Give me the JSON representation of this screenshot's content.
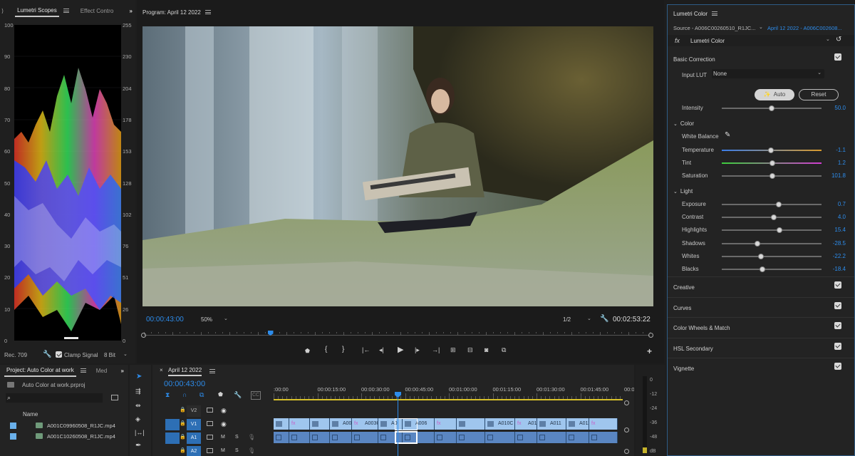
{
  "scopes": {
    "tab_active": "Lumetri Scopes",
    "tab_other": "Effect Contro",
    "left_scale": [
      "100",
      "90",
      "80",
      "70",
      "60",
      "50",
      "40",
      "30",
      "20",
      "10",
      "0"
    ],
    "right_scale": [
      "255",
      "230",
      "204",
      "178",
      "153",
      "128",
      "102",
      "76",
      "51",
      "26",
      "0"
    ],
    "colorspace": "Rec. 709",
    "clamp_label": "Clamp Signal",
    "bit_depth": "8 Bit"
  },
  "program": {
    "title": "Program: April 12 2022",
    "timecode": "00:00:43:00",
    "zoom": "50%",
    "resolution": "1/2",
    "duration": "00:02:53:22",
    "playhead_fraction": 0.25
  },
  "project": {
    "tab_active": "Project: Auto Color at work",
    "tab_other": "Med",
    "file": "Auto Color at work.prproj",
    "column_name": "Name",
    "items": [
      "A001C09960508_R1JC.mp4",
      "A001C10260508_R1JC.mp4"
    ]
  },
  "timeline": {
    "tab_label": "April 12 2022",
    "timecode": "00:00:43:00",
    "ruler": [
      ":00:00",
      "00:00:15:00",
      "00:00:30:00",
      "00:00:45:00",
      "00:01:00:00",
      "00:01:15:00",
      "00:01:30:00",
      "00:01:45:00",
      "00:02"
    ],
    "tracks": [
      {
        "name": "V2",
        "lock": "🔒"
      },
      {
        "name": "V1",
        "lock": "🔒"
      },
      {
        "name": "A1",
        "lock": "🔒",
        "m": "M",
        "s": "S"
      },
      {
        "name": "A2",
        "lock": "🔒",
        "m": "M",
        "s": "S"
      }
    ],
    "video_clips": [
      "",
      "",
      "",
      "A002",
      "A003C",
      "A0",
      "A006",
      "",
      "",
      "A010C",
      "A011C0",
      "A011",
      "A011C02",
      ""
    ],
    "audio_meter_scale": [
      "0",
      "-12",
      "-24",
      "-36",
      "-48",
      "dB"
    ]
  },
  "lumetri": {
    "title": "Lumetri Color",
    "source_label": "Source - A006C00260510_R1JC...",
    "sequence_label": "April 12 2022 - A006C002608...",
    "fx_label": "fx",
    "effect_name": "Lumetri Color",
    "basic_correction": "Basic Correction",
    "input_lut_label": "Input LUT",
    "input_lut_value": "None",
    "auto_label": "Auto",
    "reset_label": "Reset",
    "intensity": {
      "label": "Intensity",
      "value": "50.0",
      "pos": 0.5
    },
    "color_header": "Color",
    "white_balance": "White Balance",
    "color_rows": [
      {
        "label": "Temperature",
        "value": "-1.1",
        "pos": 0.49
      },
      {
        "label": "Tint",
        "value": "1.2",
        "pos": 0.51
      },
      {
        "label": "Saturation",
        "value": "101.8",
        "pos": 0.51
      }
    ],
    "light_header": "Light",
    "light_rows": [
      {
        "label": "Exposure",
        "value": "0.7",
        "pos": 0.57
      },
      {
        "label": "Contrast",
        "value": "4.0",
        "pos": 0.52
      },
      {
        "label": "Highlights",
        "value": "15.4",
        "pos": 0.58
      },
      {
        "label": "Shadows",
        "value": "-28.5",
        "pos": 0.36
      },
      {
        "label": "Whites",
        "value": "-22.2",
        "pos": 0.39
      },
      {
        "label": "Blacks",
        "value": "-18.4",
        "pos": 0.41
      }
    ],
    "sections": [
      "Creative",
      "Curves",
      "Color Wheels & Match",
      "HSL Secondary",
      "Vignette"
    ]
  },
  "colors": {
    "accent": "#2d8ceb",
    "video_clip": "#9fc6ee",
    "audio_clip": "#5a86c2",
    "fx_badge": "#c85fc8"
  }
}
